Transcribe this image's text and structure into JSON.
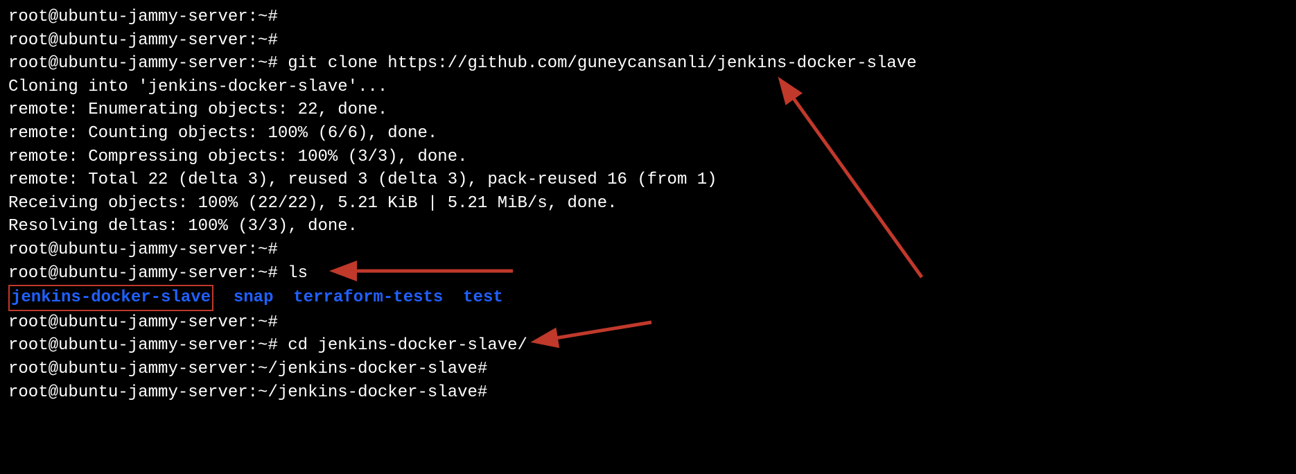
{
  "terminal": {
    "prompt_root": "root@ubuntu-jammy-server:~#",
    "prompt_subdir": "root@ubuntu-jammy-server:~/jenkins-docker-slave#",
    "lines": {
      "l1": "root@ubuntu-jammy-server:~#",
      "l2": "root@ubuntu-jammy-server:~#",
      "l3_prompt": "root@ubuntu-jammy-server:~# ",
      "l3_cmd": "git clone https://github.com/guneycansanli/jenkins-docker-slave",
      "l4": "Cloning into 'jenkins-docker-slave'...",
      "l5": "remote: Enumerating objects: 22, done.",
      "l6": "remote: Counting objects: 100% (6/6), done.",
      "l7": "remote: Compressing objects: 100% (3/3), done.",
      "l8": "remote: Total 22 (delta 3), reused 3 (delta 3), pack-reused 16 (from 1)",
      "l9": "Receiving objects: 100% (22/22), 5.21 KiB | 5.21 MiB/s, done.",
      "l10": "Resolving deltas: 100% (3/3), done.",
      "l11": "root@ubuntu-jammy-server:~#",
      "l12_prompt": "root@ubuntu-jammy-server:~# ",
      "l12_cmd": "ls",
      "l13_d1": "jenkins-docker-slave",
      "l13_d2": "snap",
      "l13_d3": "terraform-tests",
      "l13_d4": "test",
      "l14": "root@ubuntu-jammy-server:~#",
      "l15_prompt": "root@ubuntu-jammy-server:~# ",
      "l15_cmd": "cd jenkins-docker-slave/",
      "l16": "root@ubuntu-jammy-server:~/jenkins-docker-slave#",
      "l17": "root@ubuntu-jammy-server:~/jenkins-docker-slave#"
    },
    "annotations": {
      "arrow_color": "#c0392b"
    }
  }
}
